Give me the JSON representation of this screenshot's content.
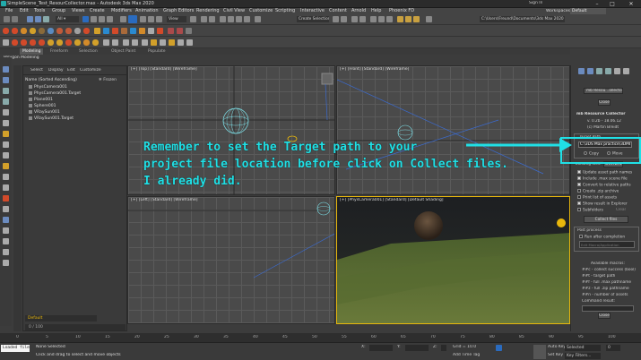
{
  "app": {
    "title": "SimpleScene_Test_ResourCollector.max - Autodesk 3ds Max 2020",
    "sign_in": "Sign In",
    "workspaces_label": "Workspaces:",
    "workspaces_value": "Default"
  },
  "menu": [
    "File",
    "Edit",
    "Tools",
    "Group",
    "Views",
    "Create",
    "Modifiers",
    "Animation",
    "Graph Editors",
    "Rendering",
    "Civil View",
    "Customize",
    "Scripting",
    "Interactive",
    "Content",
    "Arnold",
    "Help",
    "Phoenix FD"
  ],
  "toolbar": {
    "view_dropdown": "View",
    "selection_set": "Create Selection Se",
    "project_path": "C:\\Users\\Freund\\Documents\\3ds Max 2020"
  },
  "ribbon": {
    "tabs": [
      "Modeling",
      "Freeform",
      "Selection",
      "Object Paint",
      "Populate"
    ],
    "sub": "Polygon Modeling"
  },
  "explorer": {
    "tabs": [
      "Select",
      "Display",
      "Edit",
      "Customize"
    ],
    "header": "Name (Sorted Ascending)",
    "frozen_header": "Frozen",
    "items": [
      "PhysCamera001",
      "PhysCamera001.Target",
      "Plane001",
      "Sphere001",
      "VRaySun001",
      "VRaySun001.Target"
    ],
    "layer": "Default",
    "frame": "0 / 100"
  },
  "viewports": {
    "top": "[+] [Top] [Standard] [Wireframe]",
    "front": "[+] [Front] [Standard] [Wireframe]",
    "left": "[+] [Left] [Standard] [Wireframe]",
    "camera": "[+] [PhysCamera001] [Standard] [Default Shading]"
  },
  "panel": {
    "modifier_dropdown": "mb Resou...ollector",
    "close_top": "Close",
    "rollout_title": "mb Resource Collector",
    "version": "v. 0.2b - 18.06.12",
    "author": "(c) Martin Breidt",
    "target_group": "Target Path",
    "target_path": "C:\\3DS Max practice\\3DMI",
    "copy_label": "Copy",
    "move_label": "Move",
    "existing_files_label": "Existing files:",
    "existing_files_value": "Overwrite",
    "options": [
      "Update asset path names",
      "Include .max scene file",
      "Convert to relative paths",
      "Create .zip archive",
      "Print list of assets",
      "Show result in Explorer",
      "Subfolders"
    ],
    "options_checked": [
      true,
      true,
      true,
      false,
      false,
      true,
      false
    ],
    "clear_label": "Clear",
    "collect_button": "Collect files",
    "post_process_title": "Post process",
    "run_after": "Run after completion",
    "edit_macro_hint": "Edit Macro/Application",
    "available_macros_title": "Available macros:",
    "macros": [
      "##c - collect success (bool)",
      "##t - target path",
      "##f - full .max pathname",
      "##z - full .zip pathname",
      "##n - number of assets"
    ],
    "command_result_label": "Command result:",
    "close_bottom": "Close"
  },
  "annotation": "Remember to set the Target path to your\nproject file location before click on Collect files.\nI already did.",
  "timeline": {
    "ticks": [
      "0",
      "5",
      "10",
      "15",
      "20",
      "25",
      "30",
      "35",
      "40",
      "45",
      "50",
      "55",
      "60",
      "65",
      "70",
      "75",
      "80",
      "85",
      "90",
      "95",
      "100"
    ]
  },
  "status": {
    "script_listener": "Loaded file",
    "selection": "None Selected",
    "prompt": "Click and drag to select and move objects",
    "x_label": "X:",
    "y_label": "Y:",
    "z_label": "Z:",
    "grid": "Grid = 10.0",
    "add_time_tag": "Add Time Tag",
    "auto_key": "Auto Key",
    "set_key": "Set Key",
    "selected": "Selected",
    "key_filters": "Key Filters...",
    "frame_value": "0"
  },
  "colors": {
    "annotation": "#20e0e6",
    "active_viewport": "#e8b70c",
    "sphere_wire": "#7fe6ee",
    "select_blue": "#2a6bbf"
  }
}
